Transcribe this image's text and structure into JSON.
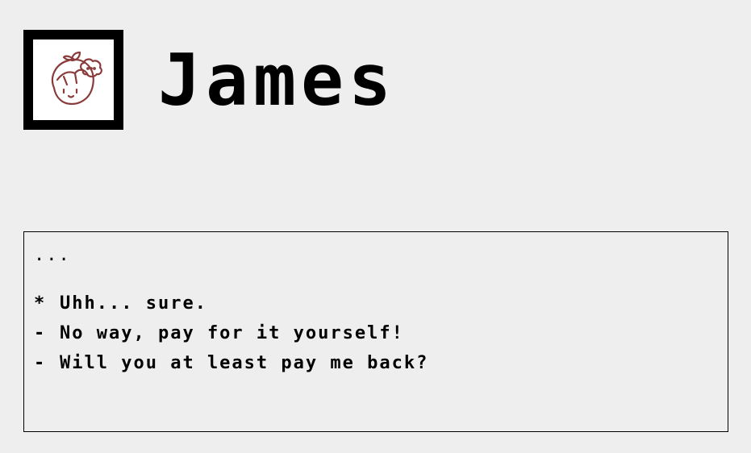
{
  "speaker": {
    "name": "James",
    "portrait_icon": "character-portrait-icon"
  },
  "dialog": {
    "text": "...",
    "choices": [
      {
        "marker": "*",
        "label": "Uhh... sure.",
        "selected": true
      },
      {
        "marker": "-",
        "label": "No way, pay for it yourself!",
        "selected": false
      },
      {
        "marker": "-",
        "label": "Will you at least pay me back?",
        "selected": false
      }
    ]
  },
  "colors": {
    "background": "#eeeeee",
    "text": "#000000",
    "portrait_line": "#8a3b3b"
  }
}
